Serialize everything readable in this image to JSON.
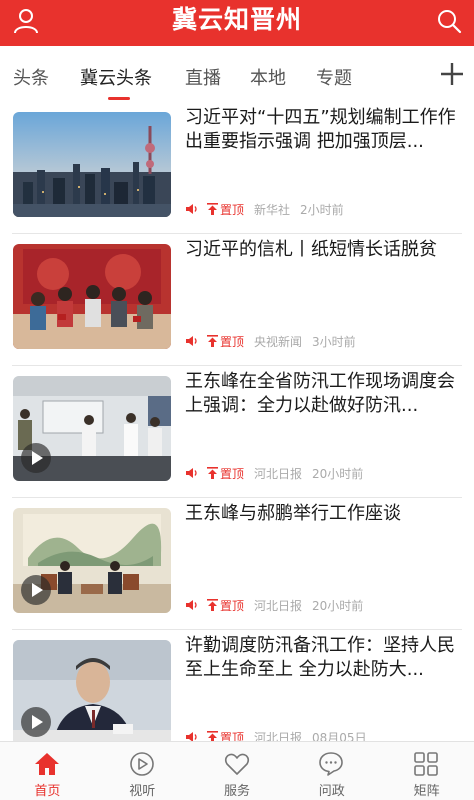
{
  "header": {
    "title": "冀云知晋州",
    "user_icon": "user-icon",
    "search_icon": "search-icon"
  },
  "tabs": [
    {
      "label": "头条",
      "active": false
    },
    {
      "label": "冀云头条",
      "active": true
    },
    {
      "label": "直播",
      "active": false
    },
    {
      "label": "本地",
      "active": false
    },
    {
      "label": "专题",
      "active": false
    }
  ],
  "accent_color": "#e8322d",
  "news": [
    {
      "title": "习近平对“十四五”规划编制工作作出重要指示强调 把加强顶层...",
      "pin": "置顶",
      "source": "新华社",
      "time": "2小时前",
      "video": false
    },
    {
      "title": "习近平的信札丨纸短情长话脱贫",
      "pin": "置顶",
      "source": "央视新闻",
      "time": "3小时前",
      "video": false
    },
    {
      "title": "王东峰在全省防汛工作现场调度会上强调：全力以赴做好防汛...",
      "pin": "置顶",
      "source": "河北日报",
      "time": "20小时前",
      "video": true
    },
    {
      "title": "王东峰与郝鹏举行工作座谈",
      "pin": "置顶",
      "source": "河北日报",
      "time": "20小时前",
      "video": true
    },
    {
      "title": "许勤调度防汛备汛工作：坚持人民至上生命至上 全力以赴防大...",
      "pin": "置顶",
      "source": "河北日报",
      "time": "08月05日",
      "video": true
    }
  ],
  "bottom_nav": [
    {
      "label": "首页",
      "icon": "home-icon",
      "active": true
    },
    {
      "label": "视听",
      "icon": "play-circle-icon",
      "active": false
    },
    {
      "label": "服务",
      "icon": "heart-icon",
      "active": false
    },
    {
      "label": "问政",
      "icon": "chat-bubble-icon",
      "active": false
    },
    {
      "label": "矩阵",
      "icon": "grid-icon",
      "active": false
    }
  ]
}
